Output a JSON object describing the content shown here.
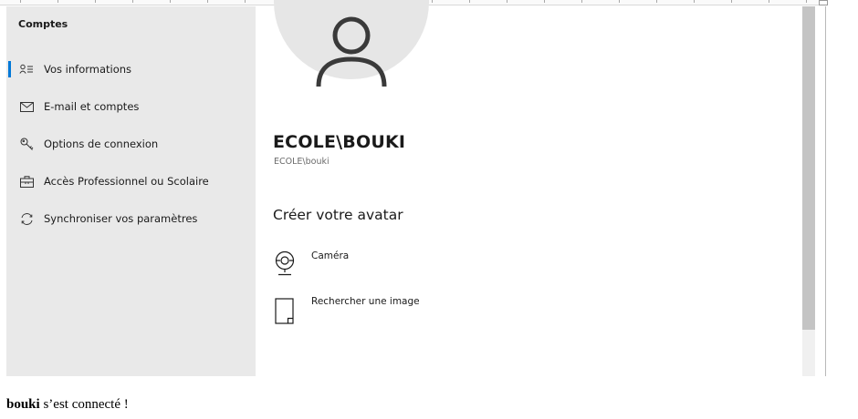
{
  "sidebar": {
    "title": "Comptes",
    "items": [
      {
        "label": "Vos informations",
        "icon": "person-info-icon",
        "active": true
      },
      {
        "label": "E-mail et comptes",
        "icon": "mail-icon"
      },
      {
        "label": "Options de connexion",
        "icon": "key-icon"
      },
      {
        "label": "Accès Professionnel ou Scolaire",
        "icon": "briefcase-icon"
      },
      {
        "label": "Synchroniser vos paramètres",
        "icon": "sync-icon"
      }
    ]
  },
  "profile": {
    "name": "ECOLE\\BOUKI",
    "account": "ECOLE\\bouki"
  },
  "avatar_section": {
    "title": "Créer votre avatar",
    "options": [
      {
        "label": "Caméra",
        "icon": "camera-icon"
      },
      {
        "label": "Rechercher une image",
        "icon": "file-icon"
      }
    ]
  },
  "status": {
    "user": "bouki",
    "message": " s’est connecté !"
  },
  "colors": {
    "accent": "#0078d7",
    "sidebar_bg": "#e9e9e9",
    "avatar_bg": "#e6e6e6"
  }
}
